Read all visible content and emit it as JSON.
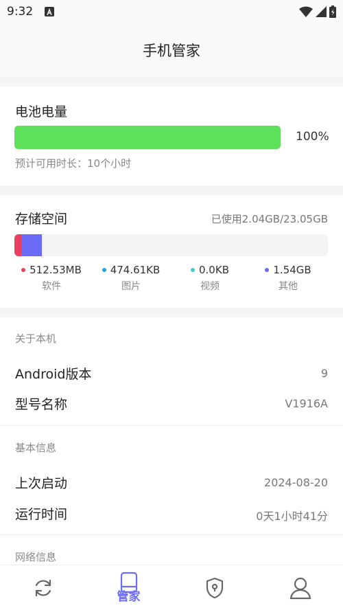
{
  "status_bar": {
    "time": "9:32"
  },
  "header": {
    "title": "手机管家"
  },
  "battery": {
    "title": "电池电量",
    "level_percent": 100,
    "percent_label": "100%",
    "estimate": "预计可用时长：10个小时",
    "bar_color": "#5ee05a"
  },
  "storage": {
    "title": "存储空间",
    "used_text": "已使用2.04GB/23.05GB",
    "segments": [
      {
        "value": "512.53MB",
        "label": "软件",
        "color": "#e8405e"
      },
      {
        "value": "474.61KB",
        "label": "图片",
        "color": "#2ba6e0"
      },
      {
        "value": "0.0KB",
        "label": "视频",
        "color": "#3ccfc2"
      },
      {
        "value": "1.54GB",
        "label": "其他",
        "color": "#6b6bf7"
      }
    ]
  },
  "about": {
    "section_title": "关于本机",
    "android_label": "Android版本",
    "android_value": "9",
    "model_label": "型号名称",
    "model_value": "V1916A"
  },
  "basic": {
    "section_title": "基本信息",
    "last_boot_label": "上次启动",
    "last_boot_value": "2024-08-20",
    "uptime_label": "运行时间",
    "uptime_value": "0天1小时41分"
  },
  "network": {
    "section_title": "网络信息"
  },
  "bottom_nav": {
    "items": [
      {
        "icon": "refresh-icon"
      },
      {
        "icon": "device-icon",
        "label": "管家",
        "active": true
      },
      {
        "icon": "shield-icon"
      },
      {
        "icon": "user-icon"
      }
    ],
    "active_color": "#6a6cf6"
  }
}
